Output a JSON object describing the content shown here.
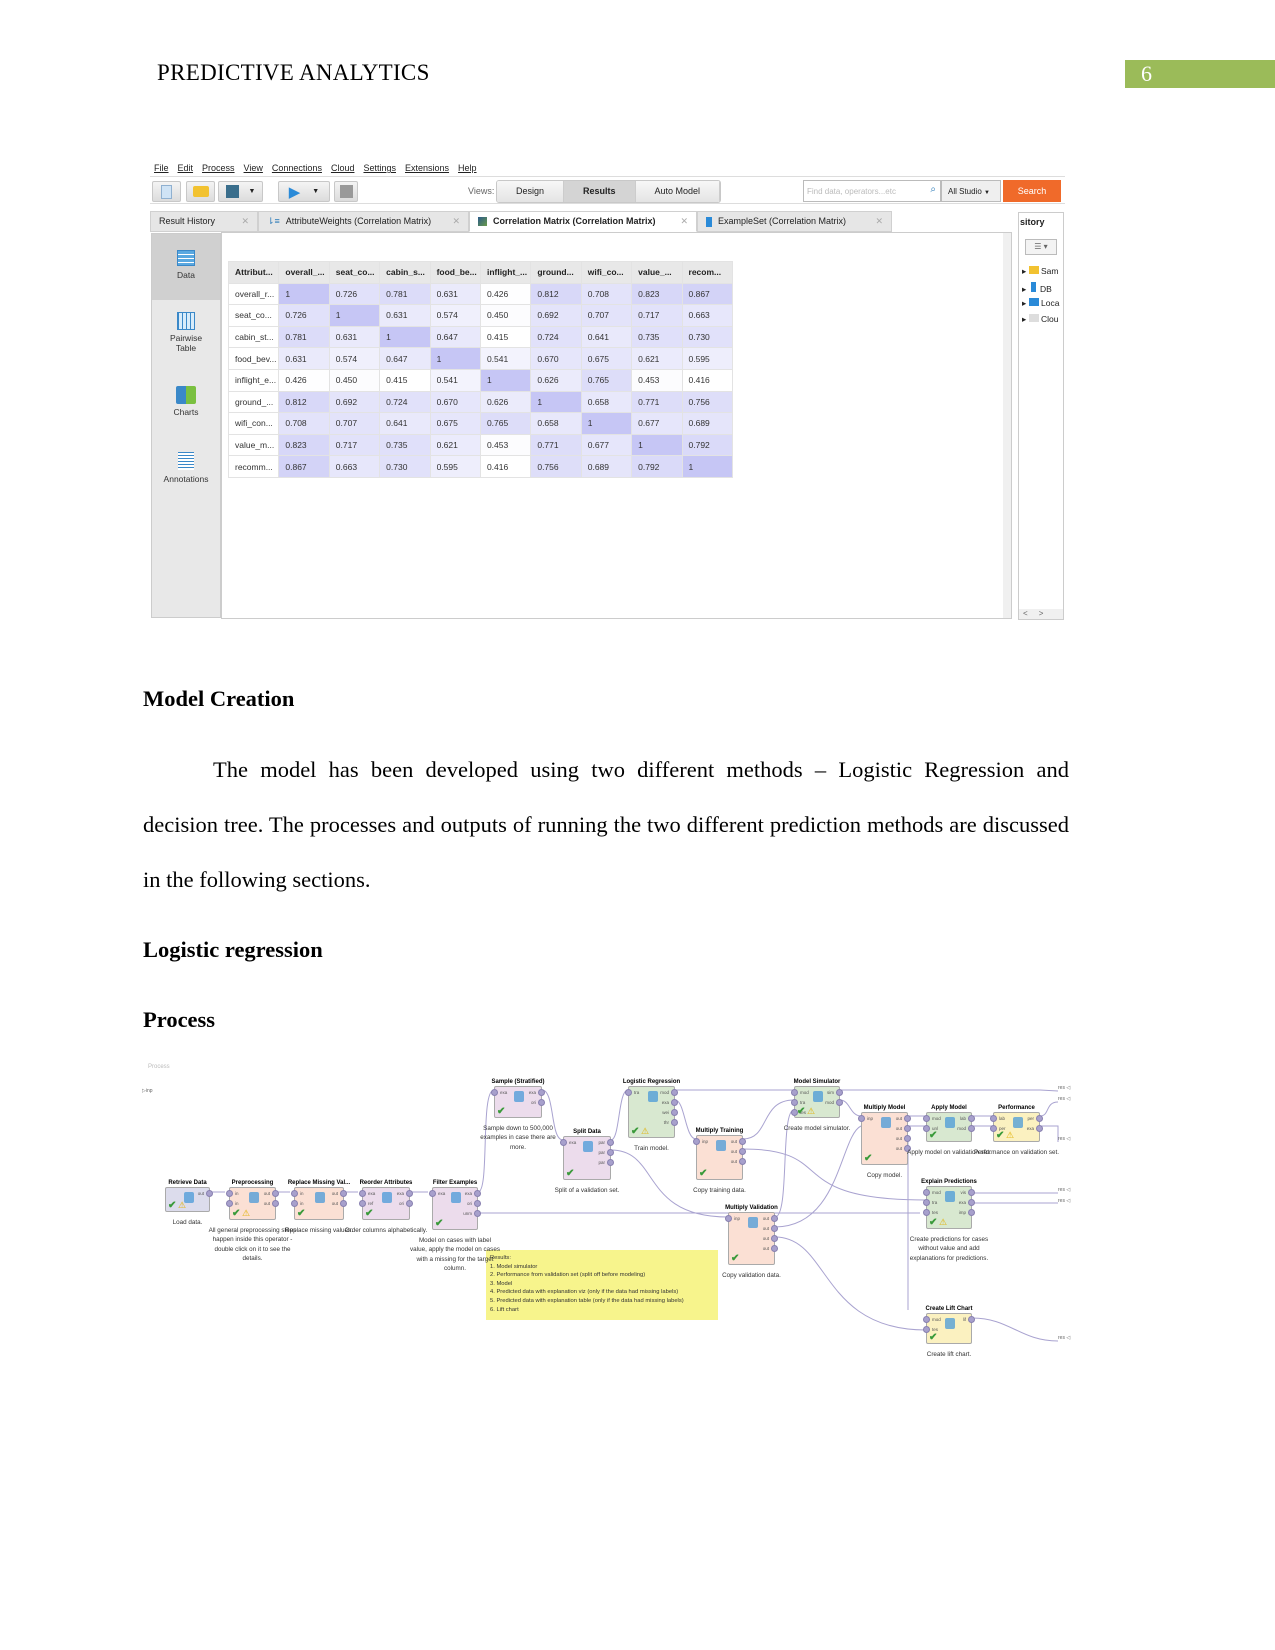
{
  "header": {
    "running_head": "PREDICTIVE ANALYTICS",
    "page_number": "6",
    "accent": "#9bbb59"
  },
  "app": {
    "menu": [
      "File",
      "Edit",
      "Process",
      "View",
      "Connections",
      "Cloud",
      "Settings",
      "Extensions",
      "Help"
    ],
    "views_label": "Views:",
    "views": [
      "Design",
      "Results",
      "Auto Model"
    ],
    "active_view": "Results",
    "search_placeholder": "Find data, operators...etc",
    "scope": "All Studio",
    "search_button": "Search",
    "search_color": "#f06a2a",
    "tabs": [
      {
        "label": "Result History",
        "icon": "history"
      },
      {
        "label": "AttributeWeights (Correlation Matrix)",
        "icon": "weights-icon"
      },
      {
        "label": "Correlation Matrix (Correlation Matrix)",
        "icon": "matrix-icon",
        "active": true
      },
      {
        "label": "ExampleSet (Correlation Matrix)",
        "icon": "table-icon"
      }
    ],
    "sidebar": [
      {
        "label": "Data",
        "icon": "table-icon",
        "active": true
      },
      {
        "label": "Pairwise Table",
        "icon": "grid-icon"
      },
      {
        "label": "Charts",
        "icon": "chart-icon"
      },
      {
        "label": "Annotations",
        "icon": "notes-icon"
      }
    ],
    "repository": {
      "title": "sitory",
      "items": [
        "Sam",
        "DB",
        "Loca",
        "Clou"
      ]
    },
    "matrix": {
      "headers": [
        "Attribut...",
        "overall_...",
        "seat_co...",
        "cabin_s...",
        "food_be...",
        "inflight_...",
        "ground...",
        "wifi_co...",
        "value_...",
        "recom..."
      ],
      "rows": [
        {
          "name": "overall_r...",
          "values": [
            "1",
            "0.726",
            "0.781",
            "0.631",
            "0.426",
            "0.812",
            "0.708",
            "0.823",
            "0.867"
          ]
        },
        {
          "name": "seat_co...",
          "values": [
            "0.726",
            "1",
            "0.631",
            "0.574",
            "0.450",
            "0.692",
            "0.707",
            "0.717",
            "0.663"
          ]
        },
        {
          "name": "cabin_st...",
          "values": [
            "0.781",
            "0.631",
            "1",
            "0.647",
            "0.415",
            "0.724",
            "0.641",
            "0.735",
            "0.730"
          ]
        },
        {
          "name": "food_bev...",
          "values": [
            "0.631",
            "0.574",
            "0.647",
            "1",
            "0.541",
            "0.670",
            "0.675",
            "0.621",
            "0.595"
          ]
        },
        {
          "name": "inflight_e...",
          "values": [
            "0.426",
            "0.450",
            "0.415",
            "0.541",
            "1",
            "0.626",
            "0.765",
            "0.453",
            "0.416"
          ]
        },
        {
          "name": "ground_...",
          "values": [
            "0.812",
            "0.692",
            "0.724",
            "0.670",
            "0.626",
            "1",
            "0.658",
            "0.771",
            "0.756"
          ]
        },
        {
          "name": "wifi_con...",
          "values": [
            "0.708",
            "0.707",
            "0.641",
            "0.675",
            "0.765",
            "0.658",
            "1",
            "0.677",
            "0.689"
          ]
        },
        {
          "name": "value_m...",
          "values": [
            "0.823",
            "0.717",
            "0.735",
            "0.621",
            "0.453",
            "0.771",
            "0.677",
            "1",
            "0.792"
          ]
        },
        {
          "name": "recomm...",
          "values": [
            "0.867",
            "0.663",
            "0.730",
            "0.595",
            "0.416",
            "0.756",
            "0.689",
            "0.792",
            "1"
          ]
        }
      ]
    }
  },
  "sections": {
    "model_creation": "Model Creation",
    "paragraph": "The model has been developed using two different methods – Logistic Regression and decision tree. The processes and outputs of running the two different prediction methods are discussed in the following sections.",
    "logistic": "Logistic regression",
    "process": "Process"
  },
  "process": {
    "canvas_label": "Process",
    "input_port": "inp",
    "result_port": "res",
    "nodes": [
      {
        "title": "Retrieve Data",
        "desc": "Load data.",
        "in": [],
        "out": [
          "out"
        ],
        "status": "warn"
      },
      {
        "title": "Preprocessing",
        "desc": "All general preprocessing steps happen inside this operator - double click on it to see the details.",
        "in": [
          "in",
          "in"
        ],
        "out": [
          "out",
          "out"
        ],
        "status": "warn"
      },
      {
        "title": "Replace Missing Val...",
        "desc": "Replace missing values.",
        "in": [
          "in",
          "in"
        ],
        "out": [
          "out",
          "out"
        ],
        "status": "ok"
      },
      {
        "title": "Reorder Attributes",
        "desc": "Order columns alphabetically.",
        "in": [
          "exa",
          "ref"
        ],
        "out": [
          "exa",
          "ori"
        ],
        "status": "ok"
      },
      {
        "title": "Filter Examples",
        "desc": "Model on cases with label value, apply the model on cases with a missing for the target column.",
        "in": [
          "exa"
        ],
        "out": [
          "exa",
          "ori",
          "unm"
        ],
        "status": "ok"
      },
      {
        "title": "Sample (Stratified)",
        "desc": "Sample down to 500,000 examples in case there are more.",
        "in": [
          "exa"
        ],
        "out": [
          "exa",
          "ori"
        ],
        "status": "ok"
      },
      {
        "title": "Split Data",
        "desc": "Split of a validation set.",
        "in": [
          "exa"
        ],
        "out": [
          "par",
          "par",
          "par"
        ],
        "status": "ok"
      },
      {
        "title": "Logistic Regression",
        "desc": "Train model.",
        "in": [
          "tra"
        ],
        "out": [
          "mod",
          "exa",
          "wei",
          "thr"
        ],
        "status": "warn"
      },
      {
        "title": "Multiply Training",
        "desc": "Copy training data.",
        "in": [
          "inp"
        ],
        "out": [
          "out",
          "out",
          "out"
        ],
        "status": "ok"
      },
      {
        "title": "Multiply Validation",
        "desc": "Copy validation data.",
        "in": [
          "inp"
        ],
        "out": [
          "out",
          "out",
          "out",
          "out"
        ],
        "status": "ok"
      },
      {
        "title": "Model Simulator",
        "desc": "Create model simulator.",
        "in": [
          "mod",
          "tra",
          "tes"
        ],
        "out": [
          "sim",
          "mod"
        ],
        "status": "warn"
      },
      {
        "title": "Multiply Model",
        "desc": "Copy model.",
        "in": [
          "inp"
        ],
        "out": [
          "out",
          "out",
          "out",
          "out"
        ],
        "status": "ok"
      },
      {
        "title": "Apply Model",
        "desc": "Apply model on validation set.",
        "in": [
          "mod",
          "unl"
        ],
        "out": [
          "lab",
          "mod"
        ],
        "status": "ok"
      },
      {
        "title": "Performance",
        "desc": "Performance on validation set.",
        "in": [
          "lab",
          "per"
        ],
        "out": [
          "per",
          "exa"
        ],
        "status": "warn"
      },
      {
        "title": "Explain Predictions",
        "desc": "Create predictions for cases without value and add explanations for predictions.",
        "in": [
          "mod",
          "tra",
          "tes"
        ],
        "out": [
          "vis",
          "exa",
          "imp"
        ],
        "status": "warn"
      },
      {
        "title": "Create Lift Chart",
        "desc": "Create lift chart.",
        "in": [
          "mod",
          "tes"
        ],
        "out": [
          "lif"
        ],
        "status": "ok"
      }
    ],
    "note": {
      "title": "Results:",
      "lines": [
        "1. Model simulator",
        "2. Performance from validation set (split off before modeling)",
        "3. Model",
        "4. Predicted data with explanation viz (only if the data had missing labels)",
        "5. Predicted data with explanation table (only if the data had missing labels)",
        "6. Lift chart"
      ]
    }
  }
}
